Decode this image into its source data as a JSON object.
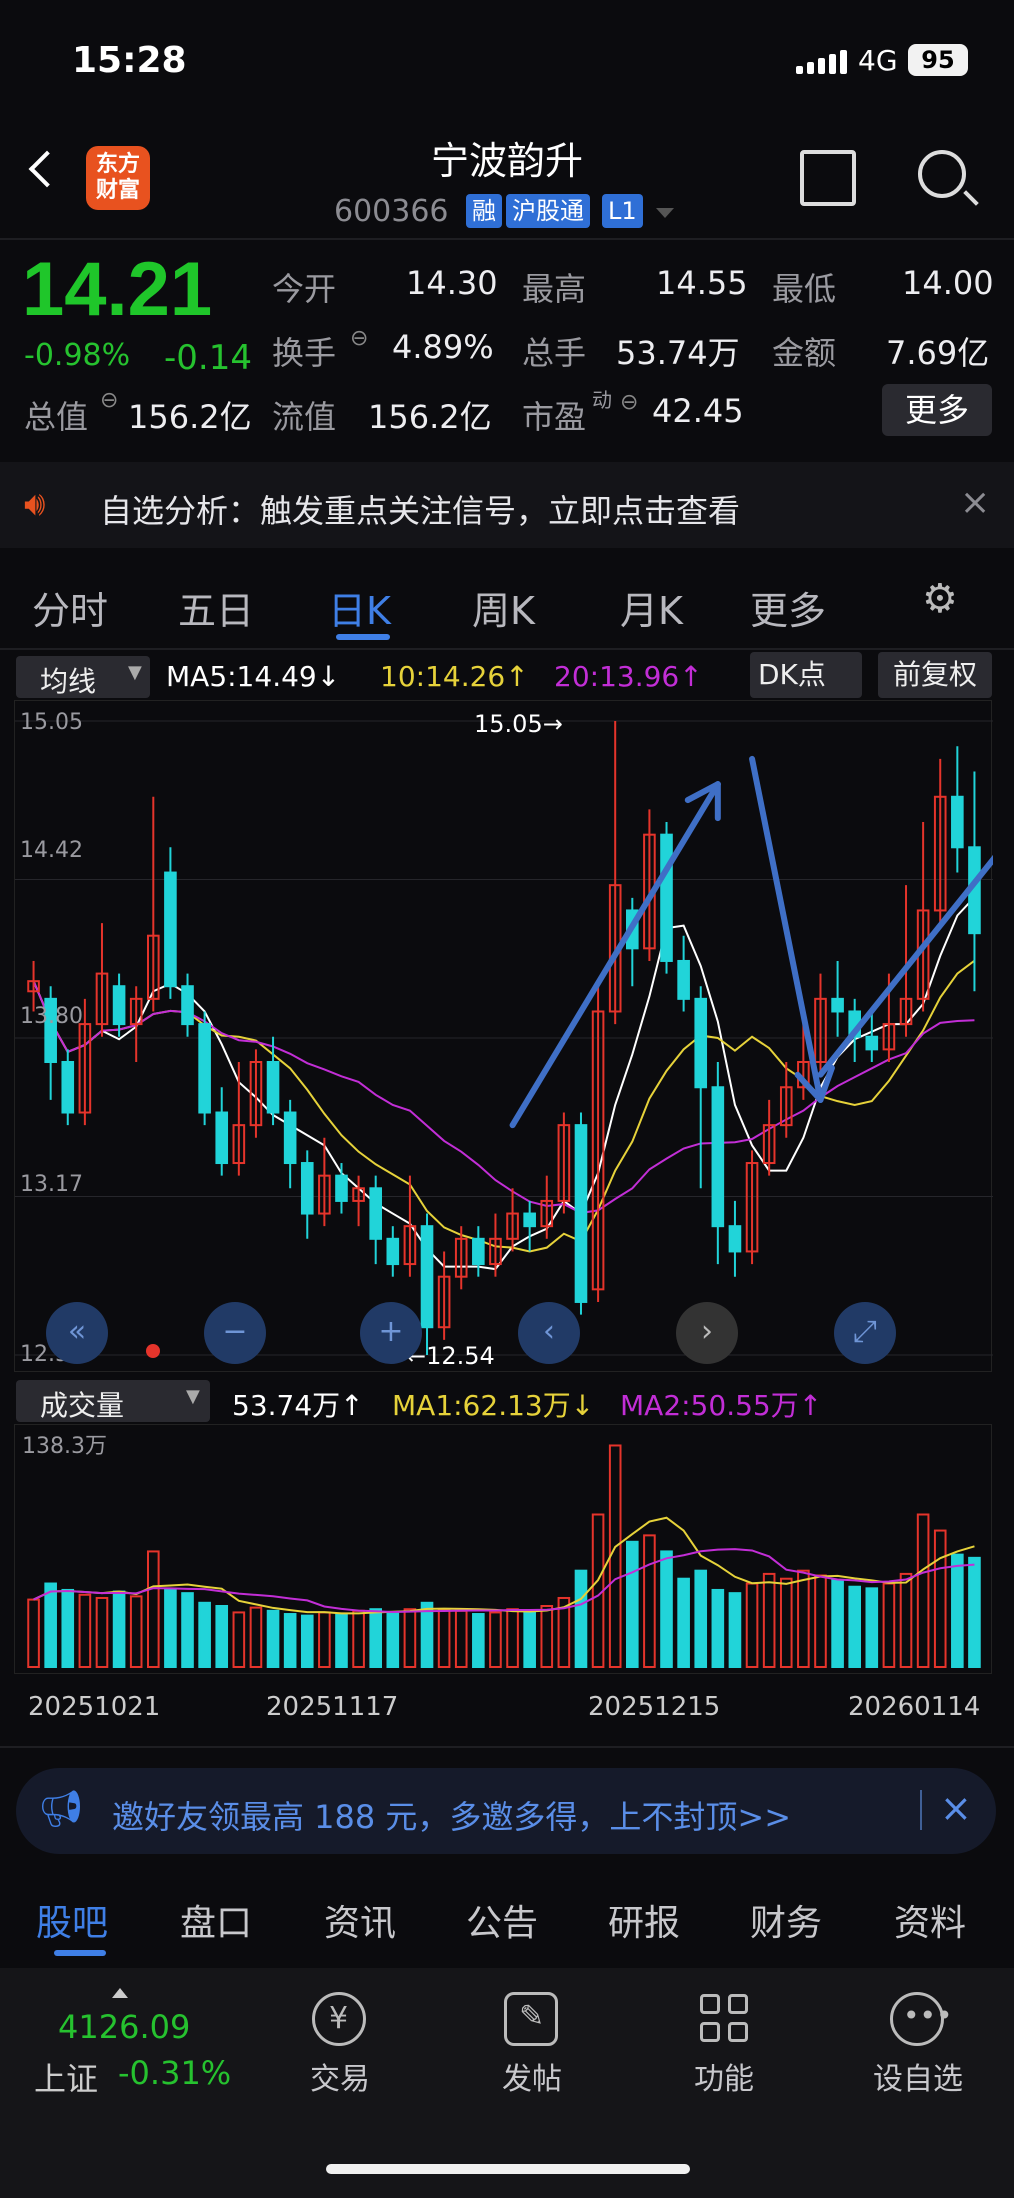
{
  "status": {
    "time": "15:28",
    "network": "4G",
    "battery": "95"
  },
  "header": {
    "title": "宁波韵升",
    "code": "600366",
    "tags": [
      "融",
      "沪股通",
      "L1"
    ],
    "logo_line1": "东方",
    "logo_line2": "财富"
  },
  "quote": {
    "price": "14.21",
    "change_pct": "-0.98%",
    "change": "-0.14",
    "open_label": "今开",
    "open": "14.30",
    "high_label": "最高",
    "high": "14.55",
    "low_label": "最低",
    "low": "14.00",
    "turnover_label": "换手",
    "turnover": "4.89%",
    "volume_label": "总手",
    "volume": "53.74万",
    "amount_label": "金额",
    "amount": "7.69亿",
    "mcap_label": "总值",
    "mcap": "156.2亿",
    "float_label": "流值",
    "float": "156.2亿",
    "pe_label": "市盈",
    "pe_super": "动",
    "pe": "42.45",
    "more": "更多"
  },
  "notice": {
    "text": "自选分析：触发重点关注信号，立即点击查看",
    "close": "×"
  },
  "tabs": [
    "分时",
    "五日",
    "日K",
    "周K",
    "月K",
    "更多"
  ],
  "active_tab": 2,
  "indicator": {
    "selector": "均线",
    "ma5": "MA5:14.49",
    "ma5_arrow": "↓",
    "ma10": "10:14.26",
    "ma10_arrow": "↑",
    "ma20": "20:13.96",
    "ma20_arrow": "↑",
    "dk": "DK点",
    "adjust": "前复权"
  },
  "price_axis": [
    "15.05",
    "14.42",
    "13.80",
    "13.17",
    "12.54"
  ],
  "annotations": {
    "max": "15.05→",
    "min": "←12.54"
  },
  "volume_bar": {
    "selector": "成交量",
    "value": "53.74万",
    "value_arrow": "↑",
    "ma1": "MA1:62.13万",
    "ma1_arrow": "↓",
    "ma2": "MA2:50.55万",
    "ma2_arrow": "↑",
    "axis_max": "138.3万"
  },
  "dates": [
    "20251021",
    "20251117",
    "20251215",
    "20260114"
  ],
  "promo": {
    "text": "邀好友领最高 188 元，多邀多得，上不封顶>>",
    "close": "×"
  },
  "bottom_tabs": [
    "股吧",
    "盘口",
    "资讯",
    "公告",
    "研报",
    "财务",
    "资料"
  ],
  "dock": {
    "index_value": "4126.09",
    "index_name": "上证",
    "index_change": "-0.31%",
    "items": [
      "交易",
      "发帖",
      "功能",
      "设自选"
    ]
  },
  "colors": {
    "up": "#e5342b",
    "down": "#21d4d9",
    "ma5": "#ffffff",
    "ma10": "#e6d23a",
    "ma20": "#c22ed6",
    "accent": "#3f7fe6"
  },
  "chart_data": {
    "type": "candlestick",
    "ylim": [
      12.54,
      15.05
    ],
    "candles": [
      [
        13.98,
        14.02,
        14.1,
        13.9
      ],
      [
        13.95,
        13.7,
        14.0,
        13.55
      ],
      [
        13.7,
        13.5,
        13.75,
        13.45
      ],
      [
        13.5,
        13.85,
        13.95,
        13.45
      ],
      [
        13.85,
        14.05,
        14.25,
        13.8
      ],
      [
        14.0,
        13.85,
        14.05,
        13.8
      ],
      [
        13.85,
        13.95,
        14.0,
        13.7
      ],
      [
        13.95,
        14.2,
        14.75,
        13.9
      ],
      [
        14.45,
        14.0,
        14.55,
        13.95
      ],
      [
        14.0,
        13.85,
        14.05,
        13.8
      ],
      [
        13.85,
        13.5,
        13.9,
        13.45
      ],
      [
        13.5,
        13.3,
        13.6,
        13.25
      ],
      [
        13.3,
        13.45,
        13.7,
        13.25
      ],
      [
        13.45,
        13.7,
        13.75,
        13.4
      ],
      [
        13.7,
        13.5,
        13.8,
        13.45
      ],
      [
        13.5,
        13.3,
        13.55,
        13.2
      ],
      [
        13.3,
        13.1,
        13.35,
        13.0
      ],
      [
        13.1,
        13.25,
        13.4,
        13.05
      ],
      [
        13.25,
        13.15,
        13.3,
        13.1
      ],
      [
        13.15,
        13.2,
        13.25,
        13.05
      ],
      [
        13.2,
        13.0,
        13.25,
        12.9
      ],
      [
        13.0,
        12.9,
        13.05,
        12.85
      ],
      [
        12.9,
        13.05,
        13.25,
        12.85
      ],
      [
        13.05,
        12.65,
        13.1,
        12.54
      ],
      [
        12.65,
        12.85,
        12.95,
        12.6
      ],
      [
        12.85,
        13.0,
        13.05,
        12.8
      ],
      [
        13.0,
        12.9,
        13.05,
        12.85
      ],
      [
        12.9,
        13.0,
        13.1,
        12.85
      ],
      [
        13.0,
        13.1,
        13.2,
        12.95
      ],
      [
        13.1,
        13.05,
        13.15,
        12.95
      ],
      [
        13.05,
        13.15,
        13.25,
        13.0
      ],
      [
        13.15,
        13.45,
        13.5,
        13.1
      ],
      [
        13.45,
        12.75,
        13.5,
        12.7
      ],
      [
        12.8,
        13.9,
        14.0,
        12.75
      ],
      [
        13.9,
        14.4,
        15.05,
        13.85
      ],
      [
        14.3,
        14.15,
        14.35,
        14.0
      ],
      [
        14.15,
        14.6,
        14.7,
        14.1
      ],
      [
        14.6,
        14.1,
        14.65,
        14.05
      ],
      [
        14.1,
        13.95,
        14.2,
        13.9
      ],
      [
        13.95,
        13.6,
        14.0,
        13.2
      ],
      [
        13.6,
        13.05,
        13.7,
        12.9
      ],
      [
        13.05,
        12.95,
        13.15,
        12.85
      ],
      [
        12.95,
        13.3,
        13.35,
        12.9
      ],
      [
        13.3,
        13.45,
        13.55,
        13.25
      ],
      [
        13.45,
        13.6,
        13.7,
        13.4
      ],
      [
        13.6,
        13.7,
        13.85,
        13.55
      ],
      [
        13.7,
        13.95,
        14.05,
        13.65
      ],
      [
        13.95,
        13.9,
        14.1,
        13.8
      ],
      [
        13.9,
        13.8,
        13.95,
        13.7
      ],
      [
        13.8,
        13.75,
        13.9,
        13.7
      ],
      [
        13.75,
        13.85,
        14.05,
        13.7
      ],
      [
        13.85,
        13.95,
        14.4,
        13.8
      ],
      [
        13.95,
        14.3,
        14.65,
        13.9
      ],
      [
        14.3,
        14.75,
        14.9,
        14.25
      ],
      [
        14.75,
        14.55,
        14.95,
        14.45
      ],
      [
        14.55,
        14.21,
        14.85,
        13.98
      ]
    ],
    "volume_max": 138.3,
    "volumes": [
      42,
      52,
      48,
      45,
      43,
      47,
      44,
      72,
      48,
      46,
      40,
      38,
      34,
      37,
      35,
      33,
      32,
      34,
      33,
      35,
      36,
      34,
      36,
      40,
      36,
      35,
      33,
      34,
      36,
      35,
      38,
      43,
      60,
      95,
      138,
      78,
      82,
      72,
      55,
      60,
      48,
      46,
      52,
      58,
      55,
      60,
      57,
      54,
      50,
      49,
      52,
      58,
      95,
      85,
      70,
      68
    ],
    "legend": [
      "MA5",
      "MA10",
      "MA20"
    ],
    "volume_legend": [
      "MA1",
      "MA2"
    ]
  }
}
